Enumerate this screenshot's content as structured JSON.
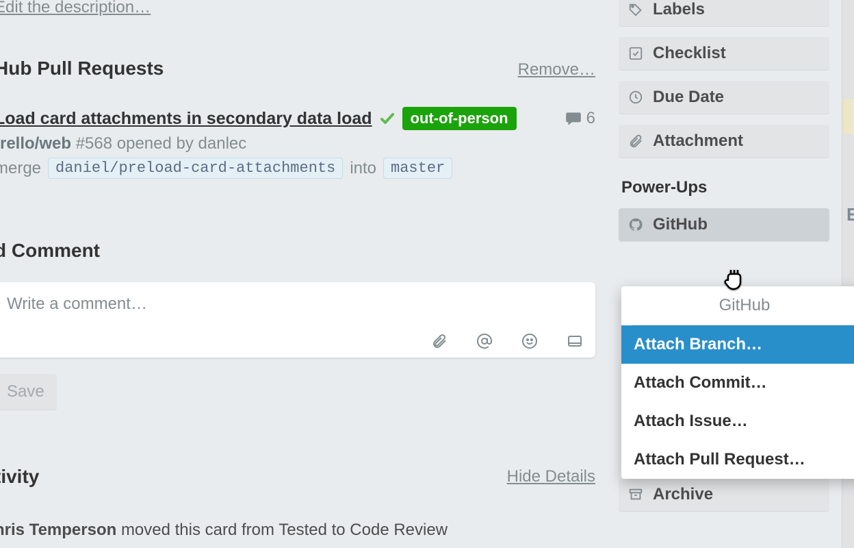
{
  "description": {
    "edit_link": "Edit the description…"
  },
  "pr_section": {
    "title": "Hub Pull Requests",
    "remove": "Remove…",
    "item": {
      "link": "Load card attachments in secondary data load",
      "status": "passing",
      "label": "out-of-person",
      "comment_count": "6",
      "repo": "trello/web",
      "pr_number": "#568",
      "opened_by_prefix": "opened by",
      "opened_by": "danlec",
      "merge_word": "merge",
      "source_branch": "daniel/preload-card-attachments",
      "into_word": "into",
      "target_branch": "master"
    }
  },
  "comment": {
    "title": "d Comment",
    "placeholder": "Write a comment…",
    "save": "Save"
  },
  "activity": {
    "title": "tivity",
    "hide_details": "Hide Details",
    "entry": {
      "user": "hris Temperson",
      "text": "moved this card from Tested to Code Review"
    }
  },
  "sidebar": {
    "labels": "Labels",
    "checklist": "Checklist",
    "due_date": "Due Date",
    "attachment": "Attachment",
    "powerups_heading": "Power-Ups",
    "github_btn": "GitHub",
    "archive": "Archive"
  },
  "popup": {
    "title": "GitHub",
    "items": [
      {
        "label": "Attach Branch…",
        "active": true
      },
      {
        "label": "Attach Commit…",
        "active": false
      },
      {
        "label": "Attach Issue…",
        "active": false
      },
      {
        "label": "Attach Pull Request…",
        "active": false
      }
    ]
  }
}
